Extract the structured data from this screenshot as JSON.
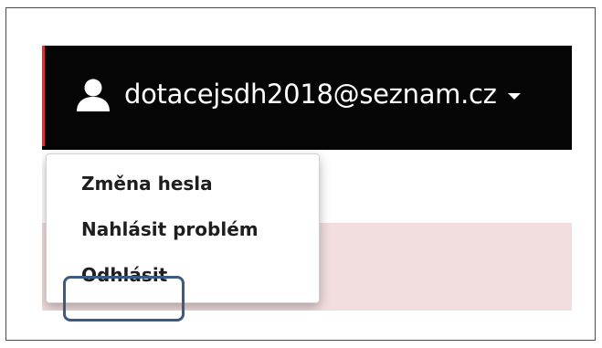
{
  "user_menu": {
    "email": "dotacejsdh2018@seznam.cz",
    "user_icon": "user-icon",
    "caret_icon": "caret-down-icon"
  },
  "dropdown": {
    "items": [
      {
        "label": "Změna hesla"
      },
      {
        "label": "Nahlásit problém"
      },
      {
        "label": "Odhlásit"
      }
    ]
  },
  "colors": {
    "navbar": "#050505",
    "page_band": "#f2dedf",
    "highlight": "#3d5a80",
    "accent_edge": "#c8383f"
  }
}
